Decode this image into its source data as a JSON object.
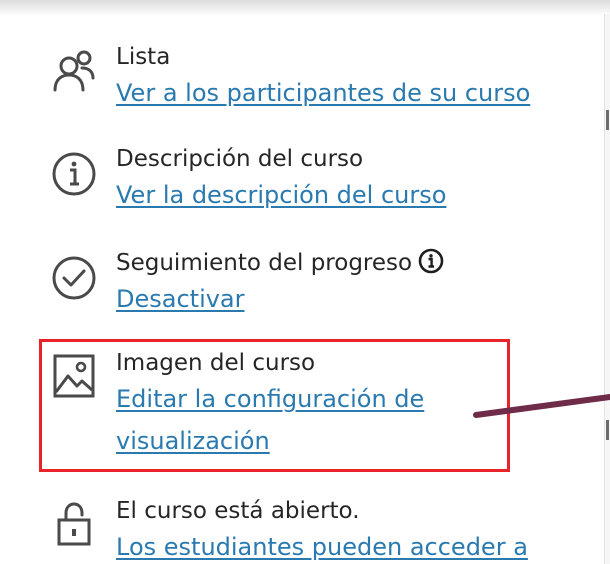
{
  "items": [
    {
      "title": "Lista",
      "link": "Ver a los participantes de su curso",
      "icon": "people-icon"
    },
    {
      "title": "Descripción del curso",
      "link": "Ver la descripción del curso",
      "icon": "info-circle-icon"
    },
    {
      "title": "Seguimiento del progreso",
      "link": "Desactivar",
      "icon": "check-circle-icon",
      "info_icon": "info-icon"
    },
    {
      "title": "Imagen del curso",
      "link_line1": "Editar la configuración de",
      "link_line2": "visualización",
      "icon": "image-icon"
    },
    {
      "title": "El curso está abierto.",
      "link": "Los estudiantes pueden acceder a",
      "icon": "unlock-icon"
    }
  ],
  "colors": {
    "link": "#2a7ab0",
    "text": "#262626",
    "highlight": "#e8232a",
    "pointer_line": "#6e2c48"
  }
}
